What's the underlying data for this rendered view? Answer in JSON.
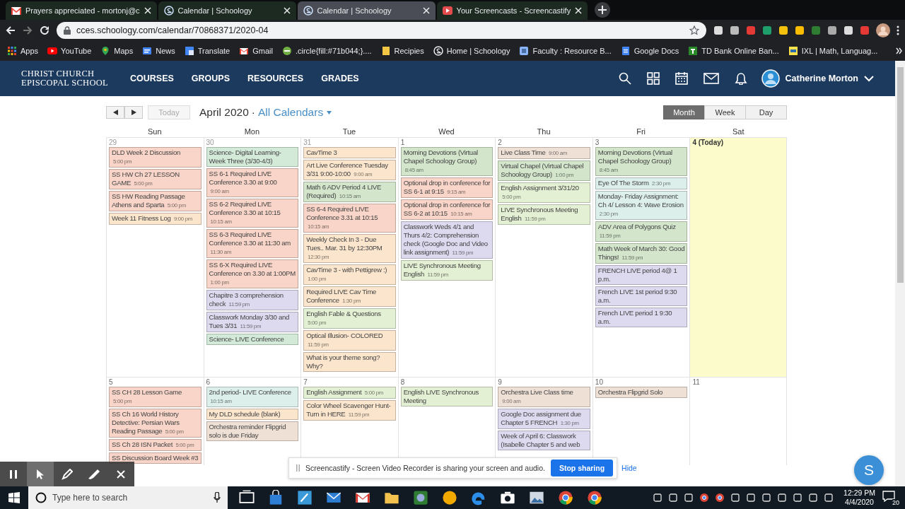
{
  "browser": {
    "tabs": [
      {
        "title": "Prayers appreciated - mortonj@c",
        "selected": false
      },
      {
        "title": "Calendar | Schoology",
        "selected": false
      },
      {
        "title": "Calendar | Schoology",
        "selected": true
      },
      {
        "title": "Your Screencasts - Screencastify",
        "selected": false
      }
    ],
    "url": "cces.schoology.com/calendar/70868371/2020-04",
    "bookmarks": [
      "Apps",
      "YouTube",
      "Maps",
      "News",
      "Translate",
      "Gmail",
      ".circle{fill:#71b044;}....",
      "Recipies",
      "Home | Schoology",
      "Faculty : Resource B...",
      "Google Docs",
      "TD Bank Online Ban...",
      "IXL | Math, Languag..."
    ]
  },
  "site": {
    "logo": [
      "CHRIST CHURCH",
      "EPISCOPAL SCHOOL"
    ],
    "nav": [
      "COURSES",
      "GROUPS",
      "RESOURCES",
      "GRADES"
    ],
    "user": "Catherine Morton"
  },
  "calendar": {
    "today_button": {
      "label": "Today",
      "disabled": true
    },
    "title": "April 2020",
    "separator": "·",
    "filter": "All Calendars",
    "views": [
      {
        "label": "Month",
        "selected": true
      },
      {
        "label": "Week",
        "selected": false
      },
      {
        "label": "Day",
        "selected": false
      }
    ],
    "weekdays": [
      "Sun",
      "Mon",
      "Tue",
      "Wed",
      "Thu",
      "Fri",
      "Sat"
    ],
    "weeks": [
      {
        "days": [
          {
            "date": "29",
            "outside": true,
            "today": false,
            "events": [
              {
                "title": "DLD Week 2 Discussion",
                "time": "5:00 pm",
                "color": "#f8d5c8"
              },
              {
                "title": "SS HW Ch 27 LESSON GAME",
                "time": "5:00 pm",
                "color": "#f8d5c8"
              },
              {
                "title": "SS HW Reading Passage Athens and Sparta",
                "time": "5:00 pm",
                "color": "#f8d5c8"
              },
              {
                "title": "Week 11 Fitness Log",
                "time": "9:00 pm",
                "color": "#fbe6cd"
              }
            ]
          },
          {
            "date": "30",
            "outside": true,
            "today": false,
            "events": [
              {
                "title": "Science- Digital Learning- Week Three (3/30-4/3)",
                "color": "#d4ead9"
              },
              {
                "title": "SS 6-1 Required LIVE Conference 3.30 at 9:00",
                "time": "9:00 am",
                "color": "#f8d5c8"
              },
              {
                "title": "SS 6-2 Required LIVE Conference 3.30 at 10:15",
                "time": "10:15 am",
                "color": "#f8d5c8"
              },
              {
                "title": "SS 6-3 Required LIVE Conference 3.30 at 11:30 am",
                "time": "11:30 am",
                "color": "#f8d5c8"
              },
              {
                "title": "SS 6-X Required LIVE Conference on 3.30 at 1:00PM",
                "time": "1:00 pm",
                "color": "#f8d5c8"
              },
              {
                "title": "Chapitre 3 comprehension check",
                "time": "11:59 pm",
                "color": "#dddaf0"
              },
              {
                "title": "Classwork Monday 3/30 and Tues 3/31",
                "time": "11:59 pm",
                "color": "#dddaf0"
              },
              {
                "title": "Science- LIVE Conference",
                "color": "#d4ead9"
              }
            ]
          },
          {
            "date": "31",
            "outside": true,
            "today": false,
            "events": [
              {
                "title": "CavTime 3",
                "color": "#fbe6cd"
              },
              {
                "title": "Art Live Conference Tuesday 3/31 9:00-10:00",
                "time": "9:00 am",
                "color": "#fbe6cd"
              },
              {
                "title": "Math 6 ADV Period 4 LIVE (Required)",
                "time": "10:15 am",
                "color": "#d3e6cc"
              },
              {
                "title": "SS 6-4 Required LIVE Conference 3.31 at 10:15",
                "time": "10:15 am",
                "color": "#f8d5c8"
              },
              {
                "title": "Weekly Check In 3 - Due Tues.. Mar. 31 by 12:30PM",
                "time": "12:30 pm",
                "color": "#fbe6cd"
              },
              {
                "title": "CavTime 3 - with Pettigrew :)",
                "time": "1:00 pm",
                "color": "#fbe6cd"
              },
              {
                "title": "Required LIVE Cav Time Conference",
                "time": "1:30 pm",
                "color": "#fbe6cd"
              },
              {
                "title": "English Fable & Questions",
                "time": "5:00 pm",
                "color": "#e4f0d3"
              },
              {
                "title": "Optical Illusion- COLORED",
                "time": "11:59 pm",
                "color": "#fbe6cd"
              },
              {
                "title": "What is your theme song? Why?",
                "color": "#fbe6cd"
              }
            ]
          },
          {
            "date": "1",
            "outside": false,
            "today": false,
            "events": [
              {
                "title": "Morning Devotions (Virtual Chapel Schoology Group)",
                "time": "8:45 am",
                "color": "#d3e6cc"
              },
              {
                "title": "Optional drop in conference for SS 6-1 at 9:15",
                "time": "9:15 am",
                "color": "#f8d5c8"
              },
              {
                "title": "Optional drop in conference for SS 6-2 at 10:15",
                "time": "10:15 am",
                "color": "#f8d5c8"
              },
              {
                "title": "Classwork Weds 4/1 and Thurs 4/2: Comprehension check (Google Doc and Video link assignment)",
                "time": "11:59 pm",
                "color": "#dddaf0"
              },
              {
                "title": "LIVE Synchronous Meeting English",
                "time": "11:59 pm",
                "color": "#e4f0d3"
              }
            ]
          },
          {
            "date": "2",
            "outside": false,
            "today": false,
            "events": [
              {
                "title": "Live Class Time",
                "time": "9:00 am",
                "color": "#efe0d6"
              },
              {
                "title": "Virtual Chapel (Virtual Chapel Schoology Group)",
                "time": "1:00 pm",
                "color": "#d3e6cc"
              },
              {
                "title": "English Assignment 3/31/20",
                "time": "5:00 pm",
                "color": "#e4f0d3"
              },
              {
                "title": "LIVE Synchronous Meeting English",
                "time": "11:59 pm",
                "color": "#e4f0d3"
              }
            ]
          },
          {
            "date": "3",
            "outside": false,
            "today": false,
            "events": [
              {
                "title": "Morning Devotions (Virtual Chapel Schoology Group)",
                "time": "8:45 am",
                "color": "#d3e6cc"
              },
              {
                "title": "Eye Of The Storm",
                "time": "2:30 pm",
                "color": "#dcefea"
              },
              {
                "title": "Monday- Friday Assignment: Ch 4/ Lesson 4: Wave Erosion",
                "time": "2:30 pm",
                "color": "#dcefea"
              },
              {
                "title": "ADV Area of Polygons Quiz",
                "time": "11:59 pm",
                "color": "#d3e6cc"
              },
              {
                "title": "Math Week of March 30: Good Things!",
                "time": "11:59 pm",
                "color": "#d3e6cc"
              },
              {
                "title": "FRENCH LIVE period 4@ 1 p.m.",
                "color": "#dddaf0"
              },
              {
                "title": "French LIVE 1st period 9:30 a.m.",
                "color": "#dddaf0"
              },
              {
                "title": "French LIVE period 1 9:30 a.m.",
                "color": "#dddaf0"
              }
            ]
          },
          {
            "date": "4 (Today)",
            "outside": false,
            "today": true
          }
        ]
      },
      {
        "days": [
          {
            "date": "5",
            "outside": false,
            "today": false,
            "events": [
              {
                "title": "SS CH 28 Lesson Game",
                "time": "5:00 pm",
                "color": "#f8d5c8"
              },
              {
                "title": "SS Ch 16 World History Detective: Persian Wars Reading Passage",
                "time": "5:00 pm",
                "color": "#f8d5c8"
              },
              {
                "title": "SS Ch 28 ISN Packet",
                "time": "5:00 pm",
                "color": "#f8d5c8"
              },
              {
                "title": "SS Discussion Board Week #3",
                "color": "#f8d5c8"
              }
            ]
          },
          {
            "date": "6",
            "outside": false,
            "today": false,
            "events": [
              {
                "title": "2nd period- LIVE Conference",
                "time": "10:15 am",
                "color": "#dcefea"
              },
              {
                "title": "My DLD schedule (blank)",
                "color": "#fbe6cd"
              },
              {
                "title": "Orchestra reminder Flipgrid solo is due Friday",
                "color": "#efe0d6"
              }
            ]
          },
          {
            "date": "7",
            "outside": false,
            "today": false,
            "events": [
              {
                "title": "English Assignment",
                "time": "5:00 pm",
                "color": "#e4f0d3"
              },
              {
                "title": "Color Wheel Scavenger Hunt- Turn in HERE",
                "time": "11:59 pm",
                "color": "#fbe6cd"
              }
            ]
          },
          {
            "date": "8",
            "outside": false,
            "today": false,
            "events": [
              {
                "title": "English LIVE Synchronous Meeting",
                "color": "#e4f0d3"
              }
            ]
          },
          {
            "date": "9",
            "outside": false,
            "today": false,
            "events": [
              {
                "title": "Orchestra Live Class time",
                "time": "9:00 am",
                "color": "#efe0d6"
              },
              {
                "title": "Google Doc assignment due Chapter 5 FRENCH",
                "time": "1:30 pm",
                "color": "#dddaf0"
              },
              {
                "title": "Week of April 6: Classwork (Isabelle Chapter 5 and web",
                "color": "#dddaf0"
              }
            ]
          },
          {
            "date": "10",
            "outside": false,
            "today": false,
            "events": [
              {
                "title": "Orchestra Flipgrid Solo",
                "color": "#efe0d6"
              }
            ]
          },
          {
            "date": "11",
            "outside": false,
            "today": false
          }
        ]
      }
    ]
  },
  "screencastify": {
    "message": "Screencastify - Screen Video Recorder is sharing your screen and audio.",
    "stop_button": "Stop sharing",
    "hide_link": "Hide",
    "launcher": "S"
  },
  "taskbar": {
    "search_placeholder": "Type here to search",
    "time": "12:29 PM",
    "date": "4/4/2020",
    "notifications": "20"
  }
}
